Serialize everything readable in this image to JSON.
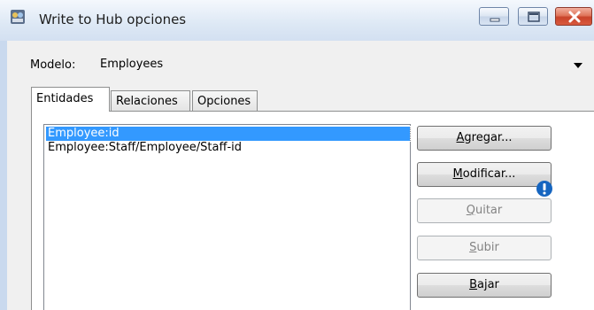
{
  "window": {
    "title": "Write to Hub opciones"
  },
  "model": {
    "label": "Modelo:",
    "value": "Employees"
  },
  "tabs": [
    {
      "label": "Entidades",
      "active": true
    },
    {
      "label": "Relaciones",
      "active": false
    },
    {
      "label": "Opciones",
      "active": false
    }
  ],
  "entities": [
    {
      "label": "Employee:id",
      "selected": true
    },
    {
      "label": "Employee:Staff/Employee/Staff-id",
      "selected": false
    }
  ],
  "buttons": {
    "add": {
      "first": "A",
      "rest": "gregar...",
      "enabled": true
    },
    "modify": {
      "first": "M",
      "rest": "odificar...",
      "enabled": true
    },
    "remove": {
      "first": "Q",
      "rest": "uitar",
      "enabled": false
    },
    "up": {
      "first": "S",
      "rest": "ubir",
      "enabled": false
    },
    "down": {
      "first": "B",
      "rest": "ajar",
      "enabled": true
    }
  },
  "colors": {
    "selection": "#3399ff",
    "info_icon": "#1565c0"
  },
  "icons": {
    "app": "app-icon",
    "info": "info-icon"
  }
}
